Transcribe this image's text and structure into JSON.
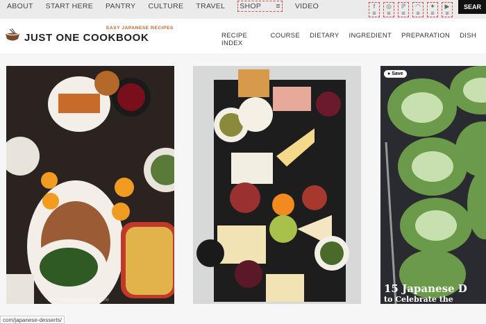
{
  "topnav": {
    "items": [
      "ABOUT",
      "START HERE",
      "PANTRY",
      "CULTURE",
      "TRAVEL",
      "SHOP",
      "VIDEO"
    ]
  },
  "social_icons": [
    "facebook-icon",
    "instagram-icon",
    "pinterest-icon",
    "rss-icon",
    "twitter-icon",
    "youtube-icon"
  ],
  "search": {
    "label": "SEAR"
  },
  "brand": {
    "tagline": "EASY JAPANESE RECIPES",
    "name": "JUST ONE COOKBOOK"
  },
  "mainnav": {
    "items": [
      "RECIPE INDEX",
      "COURSE",
      "DIETARY",
      "INGREDIENT",
      "PREPARATION",
      "DISH"
    ]
  },
  "cards": {
    "c3": {
      "save": "Save",
      "title_line1": "15 Japanese D",
      "title_line2": "to Celebrate the"
    },
    "watermark": "JUSTONECOOKBOOK.COM"
  },
  "status": {
    "url": "com/japanese-desserts/"
  }
}
